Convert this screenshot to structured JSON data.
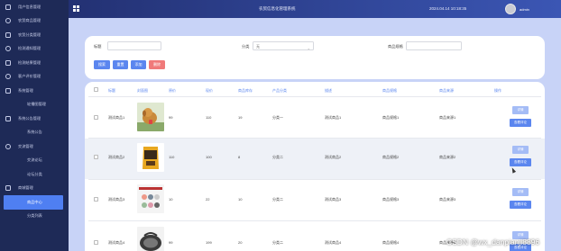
{
  "header": {
    "title": "农贸信息化管理系统",
    "datetime": "2024.04.14 10:18:35",
    "username": "admin"
  },
  "sidebar": {
    "items": [
      {
        "label": "用户信息管理",
        "icon": "user-icon"
      },
      {
        "label": "农贸商品管理",
        "icon": "shield-icon"
      },
      {
        "label": "农贸分类管理",
        "icon": "list-icon"
      },
      {
        "label": "检测通知管理",
        "icon": "bell-icon"
      },
      {
        "label": "检测结果管理",
        "icon": "doc-icon"
      },
      {
        "label": "客户评价管理",
        "icon": "gear-icon"
      },
      {
        "label": "系统管理",
        "icon": "settings-icon"
      },
      {
        "label": "轮播图管理",
        "icon": ""
      },
      {
        "label": "系统公告管理",
        "icon": "megaphone-icon"
      },
      {
        "label": "系统公告",
        "icon": ""
      },
      {
        "label": "交流管理",
        "icon": "chat-icon"
      },
      {
        "label": "交流论坛",
        "icon": ""
      },
      {
        "label": "论坛分类",
        "icon": ""
      },
      {
        "label": "商城管理",
        "icon": "shop-icon"
      },
      {
        "label": "商品中心",
        "icon": ""
      },
      {
        "label": "分类列表",
        "icon": ""
      }
    ]
  },
  "search": {
    "title_label": "标题",
    "title_value": "",
    "category_label": "分类",
    "category_value": "无",
    "spec_label": "商品规格",
    "spec_value": "",
    "buttons": {
      "search": "搜索",
      "reset": "重置",
      "add": "添加",
      "delete": "删除"
    }
  },
  "table": {
    "columns": [
      "标题",
      "封面图",
      "原价",
      "现价",
      "商品库存",
      "产品分类",
      "描述",
      "商品规格",
      "商品来源",
      "操作"
    ],
    "rows": [
      {
        "title": "测试商品1",
        "image": "dog",
        "original_price": "99",
        "price": "110",
        "stock": "19",
        "category": "分类一",
        "desc": "测试商品1",
        "spec": "商品规格1",
        "source": "商品来源1"
      },
      {
        "title": "测试商品2",
        "image": "dogfood",
        "original_price": "110",
        "price": "100",
        "stock": "8",
        "category": "分类二",
        "desc": "测试商品2",
        "spec": "商品规格2",
        "source": "商品来源2"
      },
      {
        "title": "测试商品3",
        "image": "shoes",
        "original_price": "10",
        "price": "22",
        "stock": "10",
        "category": "分类二",
        "desc": "测试商品3",
        "spec": "商品规格3",
        "source": "商品来源3"
      },
      {
        "title": "测试商品4",
        "image": "bed",
        "original_price": "99",
        "price": "199",
        "stock": "20",
        "category": "分类二",
        "desc": "测试商品4",
        "spec": "商品规格4",
        "source": "商品来源4"
      }
    ],
    "actions": {
      "detail": "详情",
      "review": "查看评论"
    }
  },
  "watermark": "CSDN @wx_danpianji8896",
  "colors": {
    "sidebar_bg": "#1e2a57",
    "accent": "#5b86ef",
    "delete": "#f07a7a",
    "page_bg": "#c8d3f7"
  }
}
